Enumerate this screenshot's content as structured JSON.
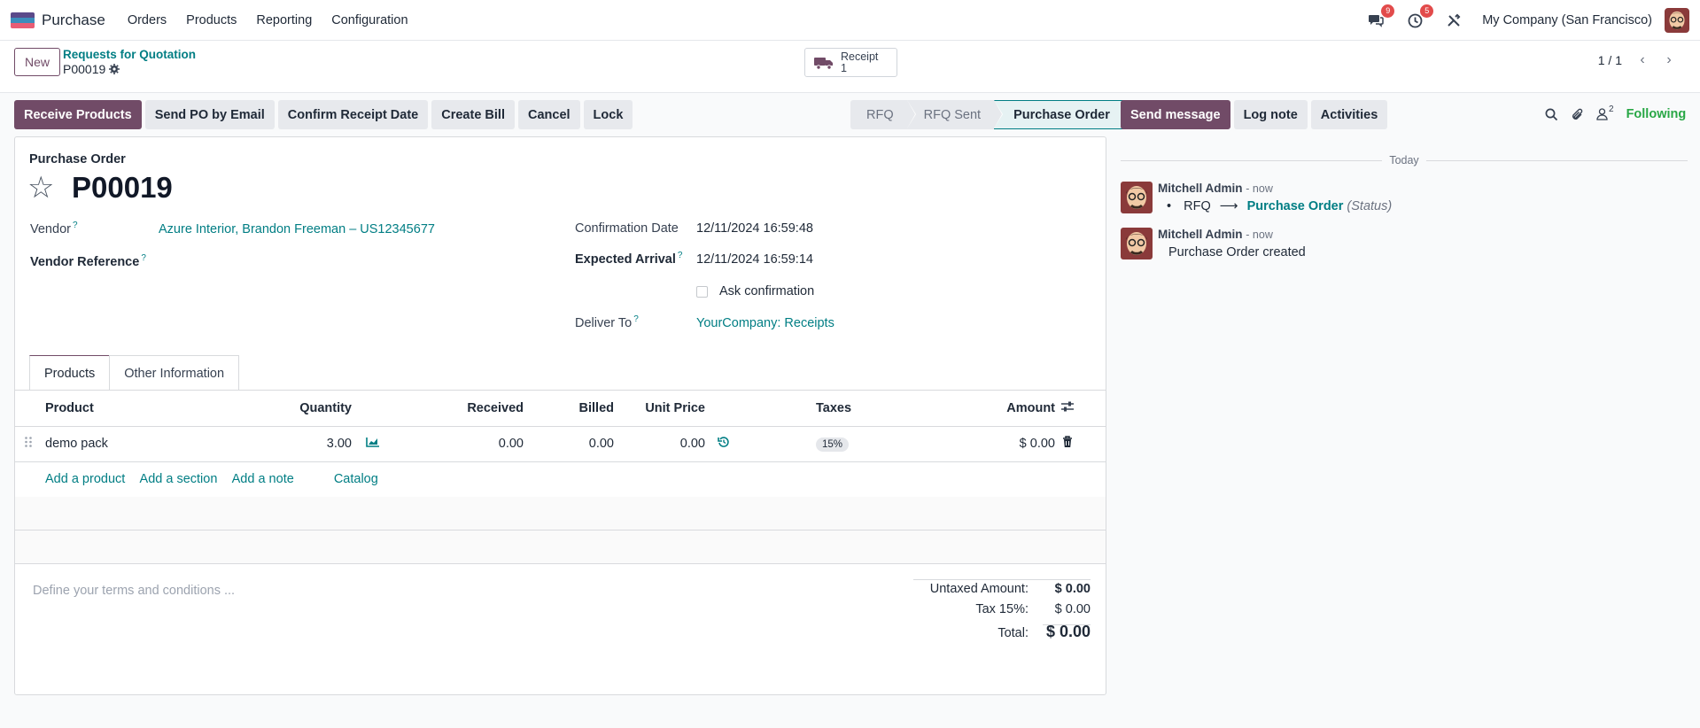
{
  "colors": {
    "brand": "#714b67",
    "link": "#017e84",
    "badge": "#e24b4b",
    "following": "#28a745"
  },
  "navbar": {
    "app_name": "Purchase",
    "menu": [
      "Orders",
      "Products",
      "Reporting",
      "Configuration"
    ],
    "messages_badge": "9",
    "activities_badge": "5",
    "company": "My Company (San Francisco)"
  },
  "control_panel": {
    "new_label": "New",
    "breadcrumb_parent": "Requests for Quotation",
    "breadcrumb_current": "P00019",
    "smart_button": {
      "label": "Receipt",
      "count": "1",
      "icon": "truck-icon"
    },
    "pager": "1 / 1"
  },
  "actions": {
    "receive_products": "Receive Products",
    "send_po_email": "Send PO by Email",
    "confirm_receipt_date": "Confirm Receipt Date",
    "create_bill": "Create Bill",
    "cancel": "Cancel",
    "lock": "Lock"
  },
  "status_stages": [
    "RFQ",
    "RFQ Sent",
    "Purchase Order"
  ],
  "active_stage": "Purchase Order",
  "form": {
    "doc_type": "Purchase Order",
    "doc_name": "P00019",
    "vendor_label": "Vendor",
    "vendor_value": "Azure Interior, Brandon Freeman – US12345677",
    "vendor_ref_label": "Vendor Reference",
    "confirmation_date_label": "Confirmation Date",
    "confirmation_date_value": "12/11/2024 16:59:48",
    "expected_arrival_label": "Expected Arrival",
    "expected_arrival_value": "12/11/2024 16:59:14",
    "ask_confirmation_label": "Ask confirmation",
    "deliver_to_label": "Deliver To",
    "deliver_to_value": "YourCompany: Receipts",
    "help_mark": "?"
  },
  "tabs": [
    "Products",
    "Other Information"
  ],
  "table": {
    "headers": {
      "product": "Product",
      "quantity": "Quantity",
      "received": "Received",
      "billed": "Billed",
      "unit_price": "Unit Price",
      "taxes": "Taxes",
      "amount": "Amount"
    },
    "rows": [
      {
        "product": "demo pack",
        "quantity": "3.00",
        "received": "0.00",
        "billed": "0.00",
        "unit_price": "0.00",
        "taxes": "15%",
        "amount": "$ 0.00"
      }
    ],
    "add_links": [
      "Add a product",
      "Add a section",
      "Add a note",
      "Catalog"
    ]
  },
  "terms_placeholder": "Define your terms and conditions ...",
  "totals": {
    "untaxed_label": "Untaxed Amount:",
    "untaxed_value": "$ 0.00",
    "tax_label": "Tax 15%:",
    "tax_value": "$ 0.00",
    "total_label": "Total:",
    "total_value": "$ 0.00"
  },
  "chatter": {
    "send_message": "Send message",
    "log_note": "Log note",
    "activities": "Activities",
    "followers_count": "2",
    "following": "Following",
    "date_separator": "Today",
    "messages": [
      {
        "author": "Mitchell Admin",
        "time": "- now",
        "from": "RFQ",
        "arrow": "⟶",
        "to": "Purchase Order",
        "field": "(Status)"
      },
      {
        "author": "Mitchell Admin",
        "time": "- now",
        "body": "Purchase Order created"
      }
    ]
  }
}
